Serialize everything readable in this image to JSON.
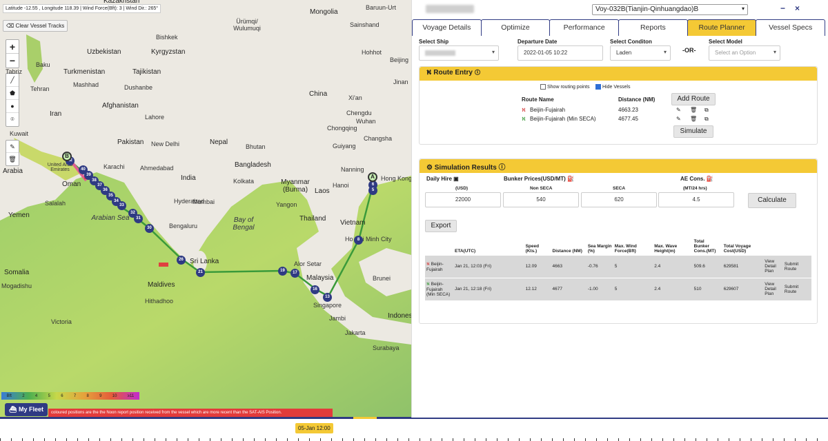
{
  "map": {
    "coordinates_text": "Latitude -12.55 , Longitude 118.39 | Wind Force(Bft): 3 | Wind Dir.: 265°",
    "clear_tracks_label": "Clear Vessel Tracks",
    "zoom_in": "+",
    "zoom_out": "−",
    "labels": [
      {
        "text": "Kazakhstan",
        "cls": "big"
      },
      {
        "text": "Mongolia",
        "cls": "big"
      },
      {
        "text": "Baruun-Urt",
        "cls": ""
      },
      {
        "text": "Ürümqi/ Wulumuqi",
        "cls": ""
      },
      {
        "text": "Sainshand",
        "cls": ""
      },
      {
        "text": "Bishkek",
        "cls": ""
      },
      {
        "text": "Uzbekistan",
        "cls": "big"
      },
      {
        "text": "Kyrgyzstan",
        "cls": "big"
      },
      {
        "text": "Hohhot",
        "cls": ""
      },
      {
        "text": "Beijing",
        "cls": ""
      },
      {
        "text": "Baku",
        "cls": ""
      },
      {
        "text": "Turkmenistan",
        "cls": "big"
      },
      {
        "text": "Tajikistan",
        "cls": "big"
      },
      {
        "text": "Jinan",
        "cls": ""
      },
      {
        "text": "Tabriz",
        "cls": ""
      },
      {
        "text": "Tehran",
        "cls": ""
      },
      {
        "text": "Mashhad",
        "cls": ""
      },
      {
        "text": "Dushanbe",
        "cls": ""
      },
      {
        "text": "China",
        "cls": "big"
      },
      {
        "text": "Xi'an",
        "cls": ""
      },
      {
        "text": "Afghanistan",
        "cls": "big"
      },
      {
        "text": "Iran",
        "cls": "big"
      },
      {
        "text": "Lahore",
        "cls": ""
      },
      {
        "text": "Wuhan",
        "cls": ""
      },
      {
        "text": "Chengdu",
        "cls": ""
      },
      {
        "text": "Chongqing",
        "cls": ""
      },
      {
        "text": "Changsha",
        "cls": ""
      },
      {
        "text": "Kuwait",
        "cls": ""
      },
      {
        "text": "Pakistan",
        "cls": "big"
      },
      {
        "text": "New Delhi",
        "cls": ""
      },
      {
        "text": "Nepal",
        "cls": "big"
      },
      {
        "text": "Bhutan",
        "cls": ""
      },
      {
        "text": "Guiyang",
        "cls": ""
      },
      {
        "text": "United Arab Emirates",
        "cls": ""
      },
      {
        "text": "Karachi",
        "cls": ""
      },
      {
        "text": "Ahmedabad",
        "cls": ""
      },
      {
        "text": "Bangladesh",
        "cls": "big"
      },
      {
        "text": "Nanning",
        "cls": ""
      },
      {
        "text": "Hong Kong",
        "cls": ""
      },
      {
        "text": "Arabia",
        "cls": "big"
      },
      {
        "text": "Oman",
        "cls": "big"
      },
      {
        "text": "India",
        "cls": "big"
      },
      {
        "text": "Kolkata",
        "cls": ""
      },
      {
        "text": "Myanmar (Burma)",
        "cls": "big"
      },
      {
        "text": "Hanoi",
        "cls": ""
      },
      {
        "text": "Laos",
        "cls": "big"
      },
      {
        "text": "Salalah",
        "cls": ""
      },
      {
        "text": "Hyderabad",
        "cls": ""
      },
      {
        "text": "Mumbai",
        "cls": ""
      },
      {
        "text": "Yangon",
        "cls": ""
      },
      {
        "text": "Yemen",
        "cls": "big"
      },
      {
        "text": "Arabian Sea",
        "cls": "sea"
      },
      {
        "text": "Bengaluru",
        "cls": ""
      },
      {
        "text": "Bay of Bengal",
        "cls": "sea"
      },
      {
        "text": "Thailand",
        "cls": "big"
      },
      {
        "text": "Vietnam",
        "cls": "big"
      },
      {
        "text": "Ho Chi Minh City",
        "cls": ""
      },
      {
        "text": "Somalia",
        "cls": "big"
      },
      {
        "text": "Sri Lanka",
        "cls": "big"
      },
      {
        "text": "Alor Setar",
        "cls": ""
      },
      {
        "text": "Malaysia",
        "cls": "big"
      },
      {
        "text": "Brunei",
        "cls": ""
      },
      {
        "text": "Maldives",
        "cls": "big"
      },
      {
        "text": "Mogadishu",
        "cls": ""
      },
      {
        "text": "Hithadhoo",
        "cls": ""
      },
      {
        "text": "Singapore",
        "cls": ""
      },
      {
        "text": "Jambi",
        "cls": ""
      },
      {
        "text": "Indonesia",
        "cls": "big"
      },
      {
        "text": "Victoria",
        "cls": ""
      },
      {
        "text": "Jakarta",
        "cls": ""
      },
      {
        "text": "Surabaya",
        "cls": ""
      }
    ],
    "waypoints": [
      "42",
      "40",
      "39",
      "38",
      "37",
      "36",
      "35",
      "34",
      "33",
      "32",
      "31",
      "30",
      "26",
      "21",
      "19",
      "17",
      "16",
      "13",
      "8",
      "6",
      "5"
    ],
    "marker_A": "A",
    "marker_B": "B",
    "wind_scale": [
      "2",
      "4",
      "5",
      "6",
      "7",
      "8",
      "9",
      "10",
      "≥11"
    ],
    "wind_scale_unit": "Bft",
    "my_fleet_label": "My Fleet",
    "notice_text": "coloured positions are the the Noon report position received from the vessel which are more recent than the SAT-AIS Position."
  },
  "timeline": {
    "current_label": "05-Jan 12:00"
  },
  "header": {
    "voyage_select": "Voy-032B(Tianjin-Qinhuangdao)B",
    "minimize": "−",
    "close": "×"
  },
  "tabs": [
    "Voyage Details",
    "Optimize",
    "Performance",
    "Reports",
    "Route Planner",
    "Vessel Specs"
  ],
  "form": {
    "ship_label": "Select Ship",
    "departure_label": "Departure Date",
    "departure_value": "2022-01-05 10:22",
    "condition_label": "Select Conditon",
    "condition_value": "Laden",
    "or_text": "-OR-",
    "model_label": "Select Model",
    "model_placeholder": "Select an Option"
  },
  "route_entry": {
    "title": "Route Entry",
    "show_routing_points": "Show routing points",
    "hide_vessels": "Hide Vessels",
    "col_route": "Route Name",
    "col_distance": "Distance (NM)",
    "add_route": "Add Route",
    "routes": [
      {
        "name": "Beijin-Fujairah",
        "distance": "4663.23",
        "color": "#d43b3b"
      },
      {
        "name": "Beijin-Fujairah (Min SECA)",
        "distance": "4677.45",
        "color": "#3a9a3a"
      }
    ],
    "simulate": "Simulate"
  },
  "simulation": {
    "title": "Simulation Results",
    "daily_hire_label": "Daily Hire",
    "daily_hire_unit": "(USD)",
    "daily_hire_value": "22000",
    "bunker_label": "Bunker Prices(USD/MT)",
    "non_seca_label": "Non SECA",
    "non_seca_value": "540",
    "seca_label": "SECA",
    "seca_value": "620",
    "ae_label": "AE Cons.",
    "ae_unit": "(MT/24 hrs)",
    "ae_value": "4.5",
    "calculate": "Calculate",
    "export": "Export",
    "columns": [
      "",
      "ETA(UTC)",
      "Speed (Kts.)",
      "Distance (NM)",
      "Sea Margin (%)",
      "Max. Wind Force(Bft)",
      "Max. Wave Height(m)",
      "Total Bunker Cons.(MT)",
      "Total Voyage Cost(USD)",
      "",
      ""
    ],
    "rows": [
      {
        "route": "Beijin-Fujairah",
        "eta": "Jan 21, 12:03 (Fri)",
        "speed": "12.09",
        "distance": "4663",
        "sea_margin": "-0.76",
        "wind": "5",
        "wave": "2.4",
        "bunker": "509.6",
        "cost": "629581",
        "view": "View Detail Plan",
        "submit": "Submit Route",
        "color": "#d43b3b"
      },
      {
        "route": "Beijin-Fujairah (Min SECA)",
        "eta": "Jan 21, 12:18 (Fri)",
        "speed": "12.12",
        "distance": "4677",
        "sea_margin": "-1.00",
        "wind": "5",
        "wave": "2.4",
        "bunker": "510",
        "cost": "629607",
        "view": "View Detail Plan",
        "submit": "Submit Route",
        "color": "#3a9a3a"
      }
    ]
  },
  "colors": {
    "accent": "#f4c935",
    "brand": "#2f3a83"
  }
}
